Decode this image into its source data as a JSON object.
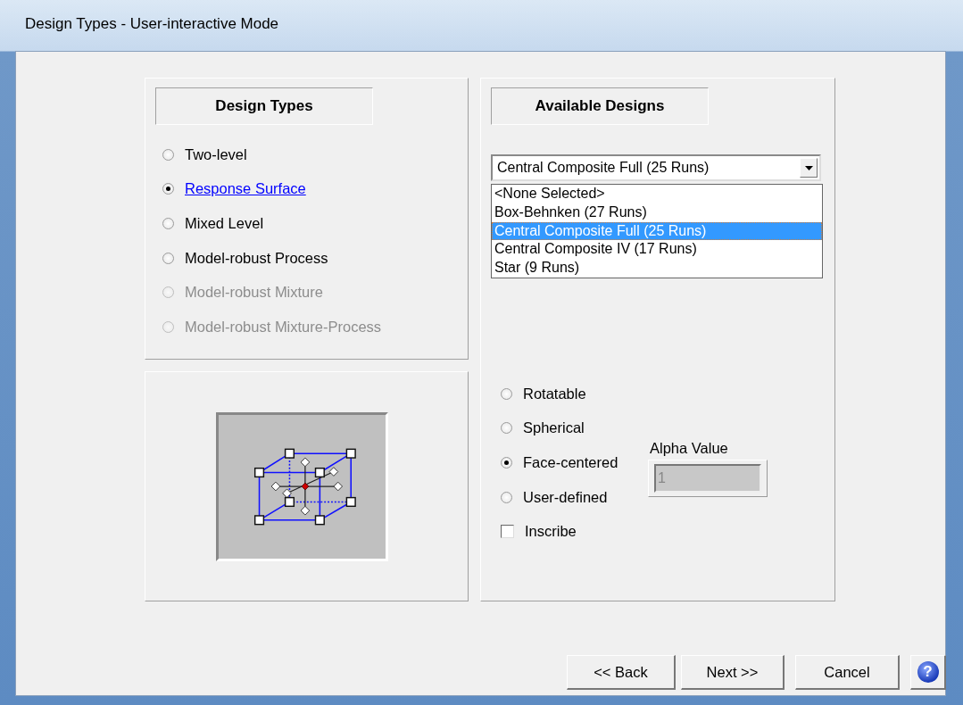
{
  "window": {
    "title": "Design Types - User-interactive Mode"
  },
  "design_types": {
    "heading": "Design Types",
    "options": [
      {
        "label": "Two-level",
        "selected": false,
        "disabled": false
      },
      {
        "label": "Response Surface",
        "selected": true,
        "disabled": false
      },
      {
        "label": "Mixed Level",
        "selected": false,
        "disabled": false
      },
      {
        "label": "Model-robust Process",
        "selected": false,
        "disabled": false
      },
      {
        "label": "Model-robust Mixture",
        "selected": false,
        "disabled": true
      },
      {
        "label": "Model-robust Mixture-Process",
        "selected": false,
        "disabled": true
      }
    ]
  },
  "available_designs": {
    "heading": "Available Designs",
    "combo_value": "Central Composite Full (25 Runs)",
    "list": [
      {
        "label": "<None Selected>",
        "selected": false
      },
      {
        "label": "Box-Behnken (27 Runs)",
        "selected": false
      },
      {
        "label": "Central Composite Full (25 Runs)",
        "selected": true
      },
      {
        "label": "Central Composite IV (17 Runs)",
        "selected": false
      },
      {
        "label": "Star (9 Runs)",
        "selected": false
      }
    ],
    "alpha_options": [
      {
        "label": "Rotatable",
        "selected": false
      },
      {
        "label": "Spherical",
        "selected": false
      },
      {
        "label": "Face-centered",
        "selected": true
      },
      {
        "label": "User-defined",
        "selected": false
      }
    ],
    "inscribe": {
      "label": "Inscribe",
      "checked": false
    },
    "alpha_value": {
      "label": "Alpha Value",
      "value": "1",
      "disabled": true
    }
  },
  "buttons": [
    "<< Back",
    "Next >>",
    "Cancel"
  ],
  "help_button": {
    "glyph": "?"
  }
}
